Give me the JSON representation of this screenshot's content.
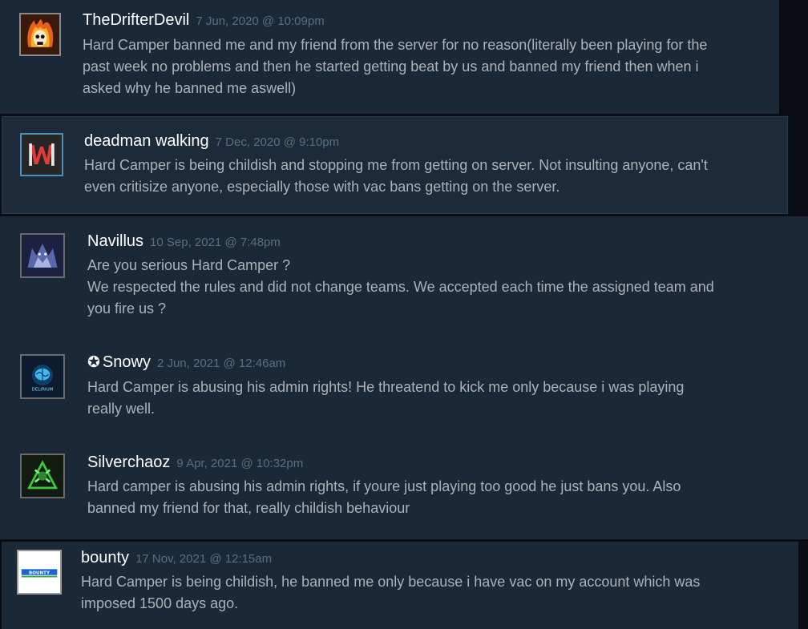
{
  "comments": [
    {
      "author": "TheDrifterDevil",
      "timestamp": "7 Jun, 2020 @ 10:09pm",
      "lines": [
        "Hard Camper banned me and my friend from the server for no reason(literally been playing for the",
        "past week no problems and then he started getting beat by us and banned my friend then when i",
        "asked why he banned me aswell)"
      ],
      "avatar_icon": "flaming-skull-icon"
    },
    {
      "author": "deadman walking",
      "timestamp": "7 Dec, 2020 @ 9:10pm",
      "lines": [
        "Hard Camper is being childish and stopping me from getting on server. Not insulting anyone, can't",
        "even critisize anyone, especially those with vac bans getting on the server."
      ],
      "avatar_icon": "w-logo-icon"
    },
    {
      "author": "Navillus",
      "timestamp": "10 Sep, 2021 @ 7:48pm",
      "lines": [
        "Are you serious Hard Camper ?",
        "We respected the rules and did not change teams. We accepted each time the assigned team and",
        "you fire us ?"
      ],
      "avatar_icon": "wolf-icon"
    },
    {
      "author": "Snowy",
      "author_prefix_icon": "star-circle-icon",
      "timestamp": "2 Jun, 2021 @ 12:46am",
      "lines": [
        "Hard Camper is abusing his admin rights! He threatend to kick me only because i was playing",
        "really well."
      ],
      "avatar_icon": "brain-icon",
      "avatar_small_text": "DELIRIUM"
    },
    {
      "author": "Silverchaoz",
      "timestamp": "9 Apr, 2021 @ 10:32pm",
      "lines": [
        "Hard camper is abusing his admin rights, if youre just playing too good he just bans you. Also",
        "banned my friend for that, really childish behaviour"
      ],
      "avatar_icon": "green-emblem-icon"
    },
    {
      "author": "bounty",
      "timestamp": "17 Nov, 2021 @ 12:15am",
      "lines": [
        "Hard Camper is being childish, he banned me only because i have vac on my account which was",
        "imposed 1500 days ago."
      ],
      "avatar_icon": "bounty-logo-icon",
      "avatar_small_text": "BOUNTY"
    }
  ],
  "colors": {
    "panel_bg": "#1b2838",
    "author": "#ffffff",
    "timestamp": "#56707f",
    "body_text": "#acb2b8"
  }
}
